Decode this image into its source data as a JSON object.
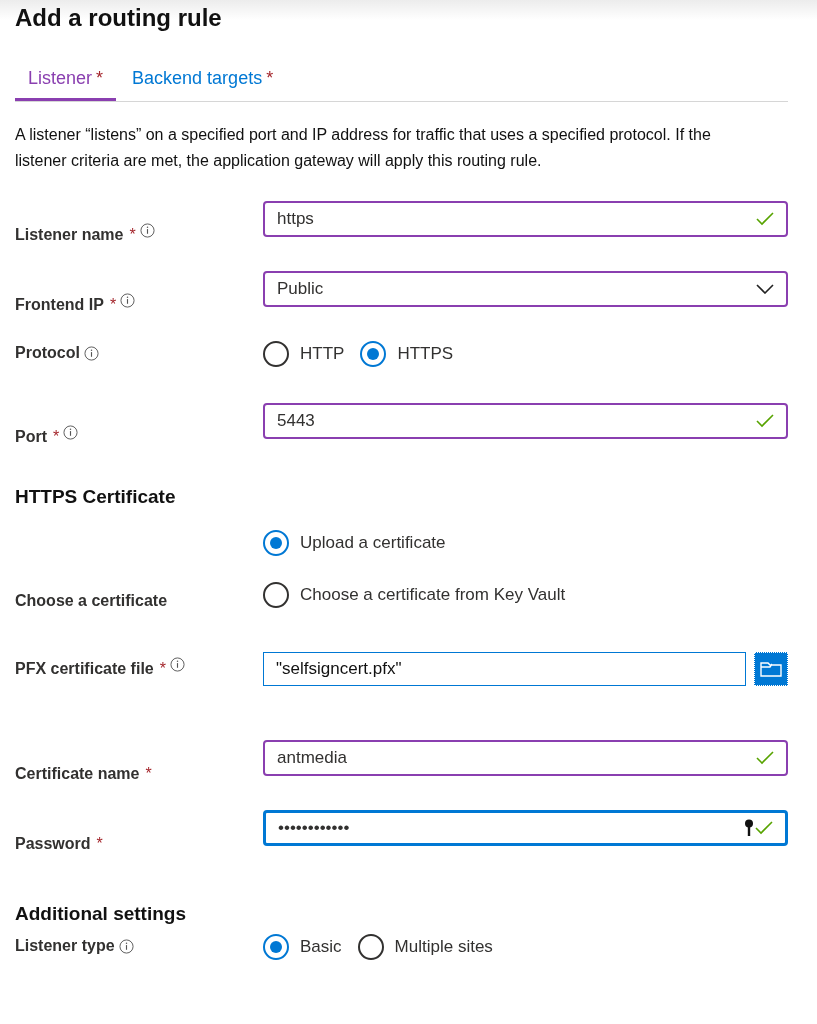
{
  "title": "Add a routing rule",
  "tabs": [
    {
      "label": "Listener",
      "required_mark": "*",
      "selected": true
    },
    {
      "label": "Backend targets",
      "required_mark": "*",
      "selected": false
    }
  ],
  "description": "A listener “listens” on a specified port and IP address for traffic that uses a specified protocol. If the listener criteria are met, the application gateway will apply this routing rule.",
  "rows": [
    {
      "kind": "text",
      "label": "Listener name",
      "required_mark": "*",
      "info": true,
      "value": "https",
      "valid": true
    },
    {
      "kind": "select",
      "label": "Frontend IP",
      "required_mark": "*",
      "info": true,
      "value": "Public"
    },
    {
      "kind": "radio",
      "label": "Protocol",
      "info": true,
      "options": [
        {
          "label": "HTTP",
          "selected": false
        },
        {
          "label": "HTTPS",
          "selected": true
        }
      ]
    },
    {
      "kind": "text",
      "label": "Port",
      "required_mark": "*",
      "info": true,
      "value": "5443",
      "valid": true
    },
    {
      "kind": "heading",
      "label": "HTTPS Certificate"
    },
    {
      "kind": "radio_stack",
      "label": "Choose a certificate",
      "options": [
        {
          "label": "Upload a certificate",
          "selected": true
        },
        {
          "label": "Choose a certificate from Key Vault",
          "selected": false
        }
      ]
    },
    {
      "kind": "file",
      "label": "PFX certificate file",
      "required_mark": "*",
      "info": true,
      "value": "\"selfsigncert.pfx\""
    },
    {
      "kind": "text",
      "label": "Certificate name",
      "required_mark": "*",
      "value": "antmedia",
      "valid": true
    },
    {
      "kind": "password",
      "label": "Password",
      "required_mark": "*",
      "value": "••••••••••••",
      "valid": true,
      "focused": true
    },
    {
      "kind": "heading2",
      "label": "Additional settings"
    },
    {
      "kind": "radio",
      "label": "Listener type",
      "info": true,
      "options": [
        {
          "label": "Basic",
          "selected": true
        },
        {
          "label": "Multiple sites",
          "selected": false
        }
      ]
    }
  ]
}
